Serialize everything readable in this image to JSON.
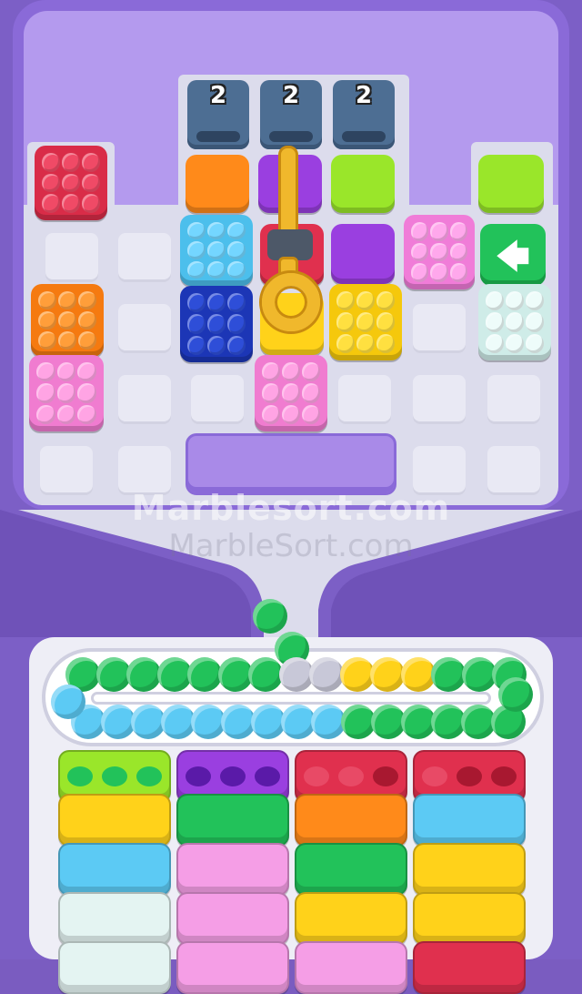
{
  "watermark": {
    "line1": "Marblesort.com",
    "line2": "MarbleSort.com"
  },
  "dispensers": [
    {
      "count": "2"
    },
    {
      "count": "2"
    },
    {
      "count": "2"
    }
  ],
  "colors": {
    "red": "#e0304e",
    "orange": "#ff8a1a",
    "purple": "#9a3fe0",
    "lime": "#9ae62a",
    "cyan": "#5ccaf4",
    "navy": "#1f3fc8",
    "pink": "#f59ee6",
    "yellow": "#ffd21a",
    "white": "#e4f4f2",
    "green": "#22c25a",
    "key": "#f0b82c"
  },
  "icons": {
    "arrow": "arrow-left-icon",
    "key": "key-icon"
  },
  "arrow_glyph": "🡄",
  "top_marbles": [
    "green",
    "green"
  ],
  "conveyor_top_row": [
    "green",
    "green",
    "green",
    "green",
    "green",
    "green",
    "green",
    "empty",
    "empty",
    "yellow",
    "yellow",
    "yellow",
    "green",
    "green",
    "green"
  ],
  "conveyor_bottom_row": [
    "cyan",
    "cyan",
    "cyan",
    "cyan",
    "cyan",
    "cyan",
    "cyan",
    "cyan",
    "cyan",
    "green",
    "green",
    "green",
    "green",
    "green",
    "green"
  ],
  "columns": [
    {
      "top": "lime",
      "holes": [
        "green",
        "green",
        "green"
      ],
      "stack": [
        "yellow",
        "cyan",
        "white",
        "white"
      ]
    },
    {
      "top": "purple",
      "holes": [
        "purple-dark",
        "purple-dark",
        "purple-dark"
      ],
      "stack": [
        "green",
        "pink",
        "pink",
        "pink"
      ]
    },
    {
      "top": "red",
      "holes": [
        "red-ball",
        "red-ball",
        "red-dark"
      ],
      "stack": [
        "orange",
        "green",
        "yellow",
        "pink"
      ]
    },
    {
      "top": "red",
      "holes": [
        "red-ball",
        "red-dark",
        "red-dark"
      ],
      "stack": [
        "cyan",
        "yellow",
        "yellow",
        "red"
      ]
    }
  ]
}
